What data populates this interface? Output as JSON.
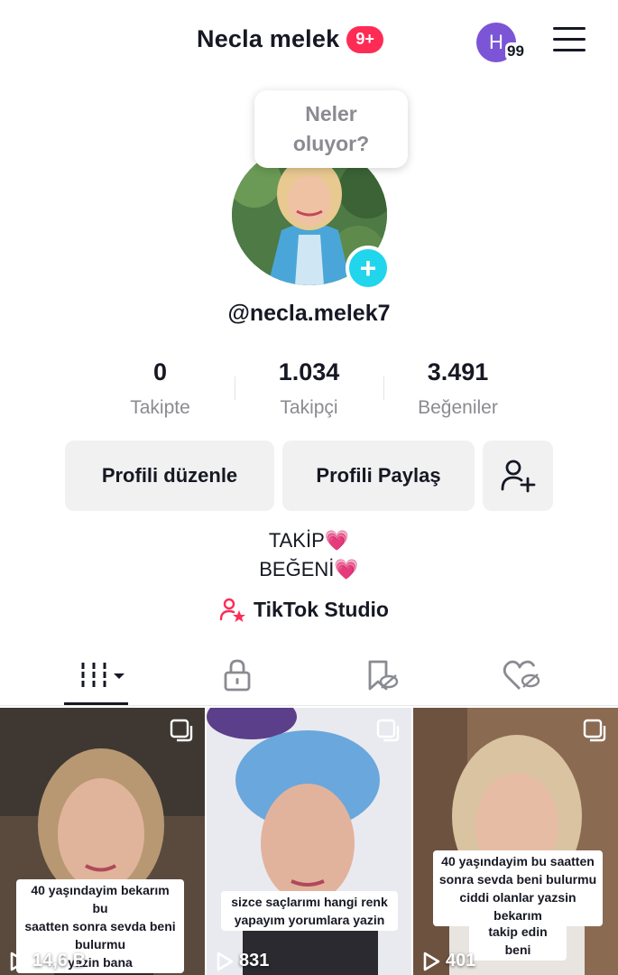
{
  "header": {
    "title": "Necla melek",
    "notification_badge": "9+",
    "account_initial": "H",
    "account_badge": "99"
  },
  "profile": {
    "bubble_text": "Neler\noluyor?",
    "add_symbol": "+",
    "username": "@necla.melek7"
  },
  "stats": [
    {
      "value": "0",
      "label": "Takipte"
    },
    {
      "value": "1.034",
      "label": "Takipçi"
    },
    {
      "value": "3.491",
      "label": "Beğeniler"
    }
  ],
  "buttons": {
    "edit_profile": "Profili düzenle",
    "share_profile": "Profili Paylaş",
    "add_friend_icon": "person-add-icon"
  },
  "bio": {
    "line1": "TAKİP💗",
    "line2": "BEĞENİ💗"
  },
  "studio": {
    "label": "TikTok Studio",
    "icon": "person-star-icon"
  },
  "tabs": [
    {
      "icon": "grid-icon",
      "active": true
    },
    {
      "icon": "lock-icon",
      "active": false
    },
    {
      "icon": "bookmark-icon",
      "active": false
    },
    {
      "icon": "heart-hidden-icon",
      "active": false
    }
  ],
  "videos": [
    {
      "caption": "40 yaşındayim bekarım bu\nsaatten sonra sevda beni\nbulurmu\nyazin bana",
      "views": "14,6 B"
    },
    {
      "caption": "sizce saçlarımı hangi renk\nyapayım yorumlara yazin",
      "views": "831"
    },
    {
      "caption": "40 yaşındayim bu saatten\nsonra sevda beni bulurmu\nciddi olanlar yazsin bekarım",
      "caption2": "takip edin beni",
      "views": "401"
    }
  ],
  "colors": {
    "accent": "#fe2c55",
    "teal": "#20d5ec",
    "text": "#161823",
    "muted": "#8a8b91",
    "button_bg": "#f1f1f2"
  }
}
